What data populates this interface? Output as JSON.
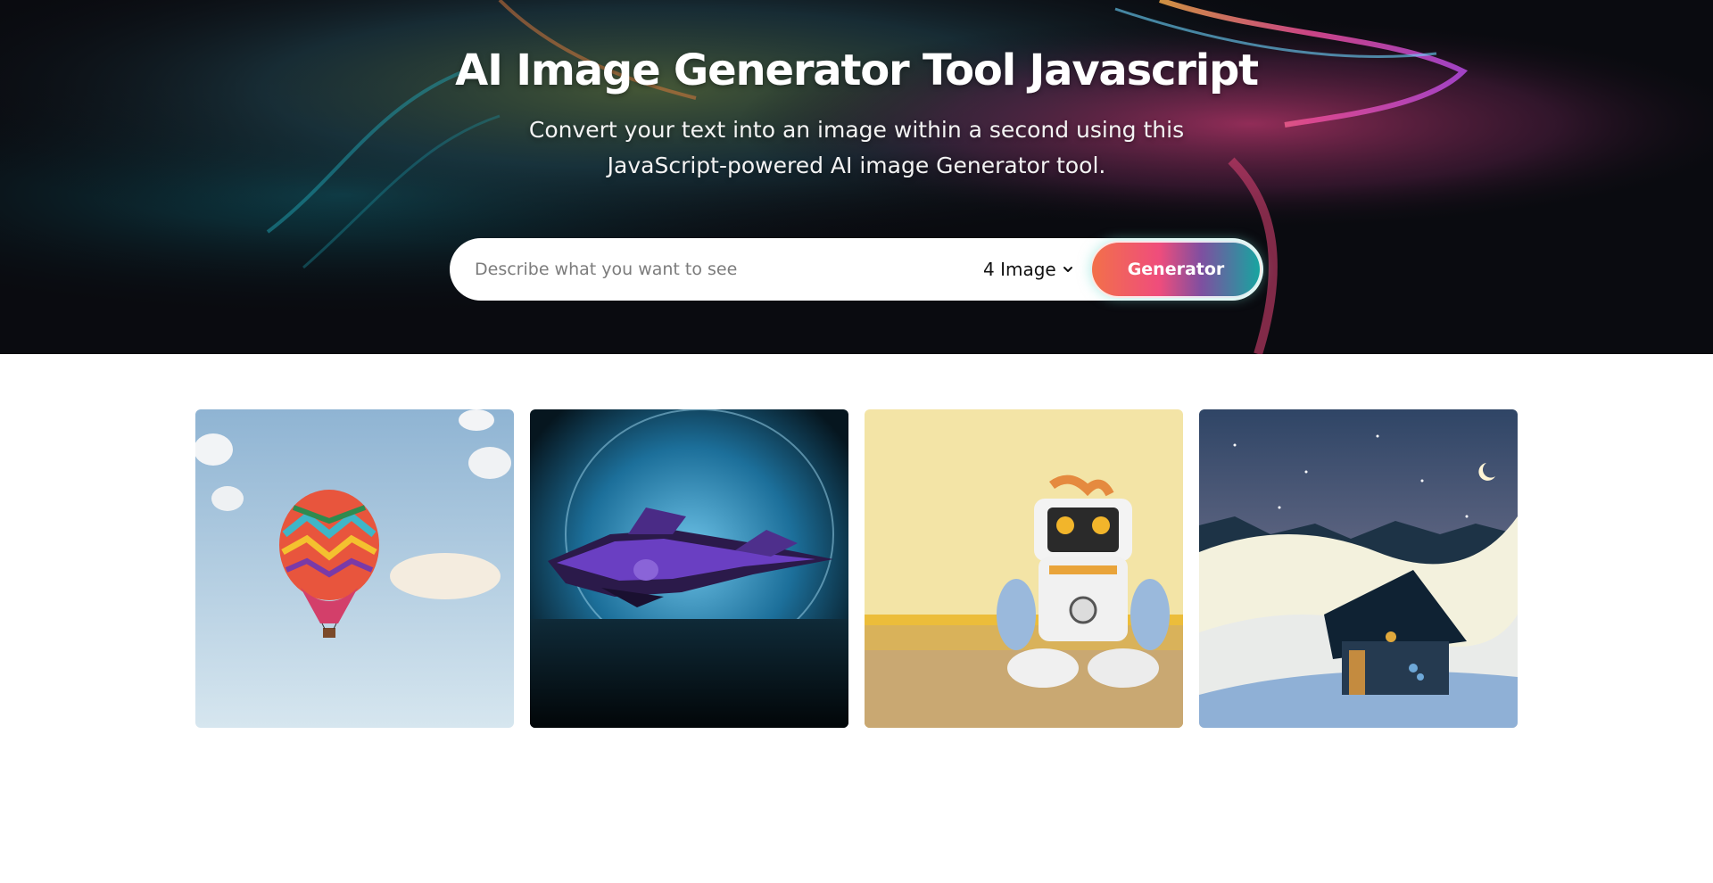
{
  "hero": {
    "title": "AI Image Generator Tool Javascript",
    "subtitle": "Convert your text into an image within a second using this JavaScript-powered AI image Generator tool."
  },
  "search": {
    "placeholder": "Describe what you want to see",
    "value": "",
    "count_selected": "4 Image",
    "count_icon": "chevron-down-icon",
    "button_label": "Generator"
  },
  "gallery": {
    "images": [
      {
        "subject": "hot-air-balloon"
      },
      {
        "subject": "spaceship"
      },
      {
        "subject": "plush-robot"
      },
      {
        "subject": "snowy-cabin-night"
      }
    ]
  },
  "colors": {
    "button_gradient": [
      "#f2704a",
      "#ef4d7c",
      "#7f4fa0",
      "#17a5a0"
    ],
    "hero_background": "#0b0b10",
    "page_background": "#ffffff"
  }
}
